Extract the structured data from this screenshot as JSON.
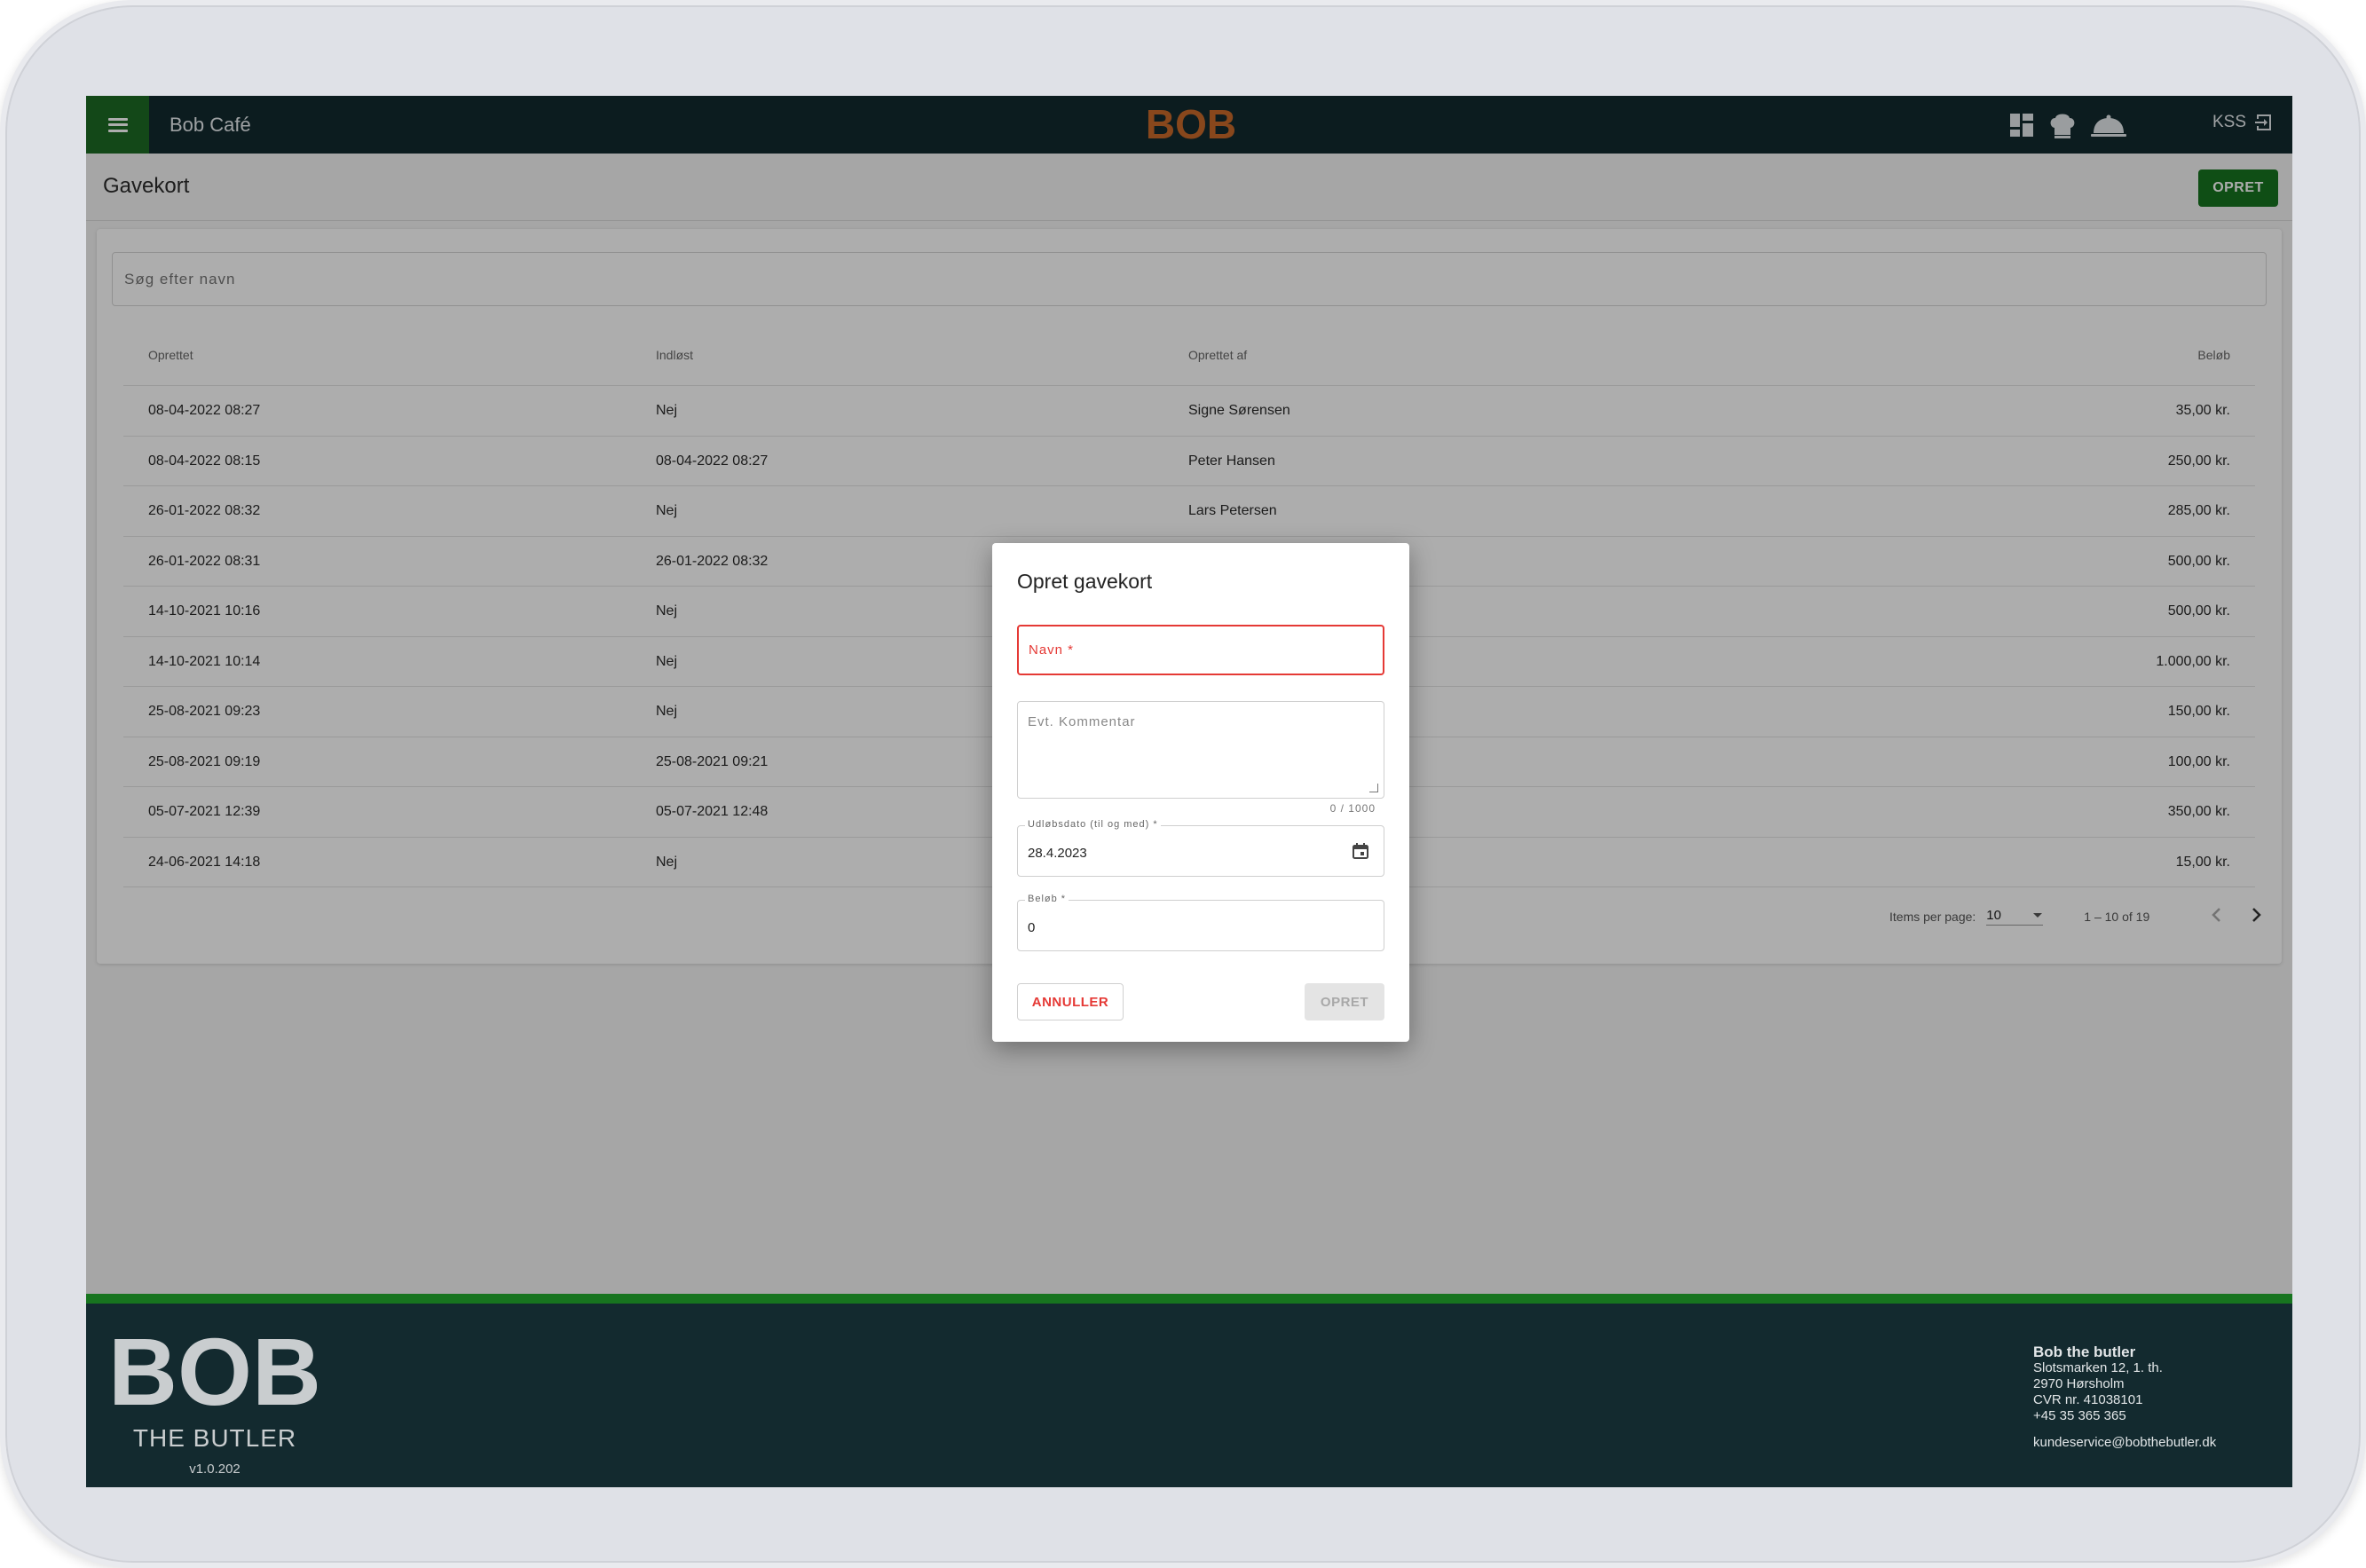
{
  "app": {
    "name": "Bob Café",
    "logo": "BOB",
    "user": "KSS"
  },
  "page": {
    "title": "Gavekort",
    "create_label": "OPRET"
  },
  "search": {
    "placeholder": "Søg efter navn"
  },
  "table": {
    "columns": [
      "Oprettet",
      "Indløst",
      "Oprettet af",
      "Beløb"
    ],
    "rows": [
      [
        "08-04-2022 08:27",
        "Nej",
        "Signe Sørensen",
        "35,00 kr."
      ],
      [
        "08-04-2022 08:15",
        "08-04-2022 08:27",
        "Peter Hansen",
        "250,00 kr."
      ],
      [
        "26-01-2022 08:32",
        "Nej",
        "Lars Petersen",
        "285,00 kr."
      ],
      [
        "26-01-2022 08:31",
        "26-01-2022 08:32",
        "",
        "500,00 kr."
      ],
      [
        "14-10-2021 10:16",
        "Nej",
        "",
        "500,00 kr."
      ],
      [
        "14-10-2021 10:14",
        "Nej",
        "",
        "1.000,00 kr."
      ],
      [
        "25-08-2021 09:23",
        "Nej",
        "",
        "150,00 kr."
      ],
      [
        "25-08-2021 09:19",
        "25-08-2021 09:21",
        "",
        "100,00 kr."
      ],
      [
        "05-07-2021 12:39",
        "05-07-2021 12:48",
        "",
        "350,00 kr."
      ],
      [
        "24-06-2021 14:18",
        "Nej",
        "",
        "15,00 kr."
      ]
    ]
  },
  "pagination": {
    "items_per_page_label": "Items per page:",
    "items_per_page": "10",
    "range": "1 – 10 of 19"
  },
  "dialog": {
    "title": "Opret gavekort",
    "name_label": "Navn *",
    "comment_placeholder": "Evt. Kommentar",
    "comment_counter": "0 / 1000",
    "date_label": "Udløbsdato (til og med) *",
    "date_value": "28.4.2023",
    "amount_label": "Beløb *",
    "amount_value": "0",
    "cancel_label": "ANNULLER",
    "submit_label": "OPRET"
  },
  "footer": {
    "logo": "BOB",
    "tagline": "THE BUTLER",
    "version": "v1.0.202",
    "company": "Bob the butler",
    "address1": "Slotsmarken 12, 1. th.",
    "address2": "2970 Hørsholm",
    "cvr": "CVR nr. 41038101",
    "phone": "+45 35 365 365",
    "email": "kundeservice@bobthebutler.dk"
  },
  "colors": {
    "topbar": "#132a2f",
    "accent_green": "#17741f",
    "error_red": "#e53935",
    "logo_orange": "#c9692a"
  },
  "icons": [
    "menu-icon",
    "dashboard-icon",
    "chef-hat-icon",
    "cloche-icon",
    "logout-icon",
    "calendar-icon",
    "chevron-down-icon",
    "chevron-left-icon",
    "chevron-right-icon"
  ]
}
